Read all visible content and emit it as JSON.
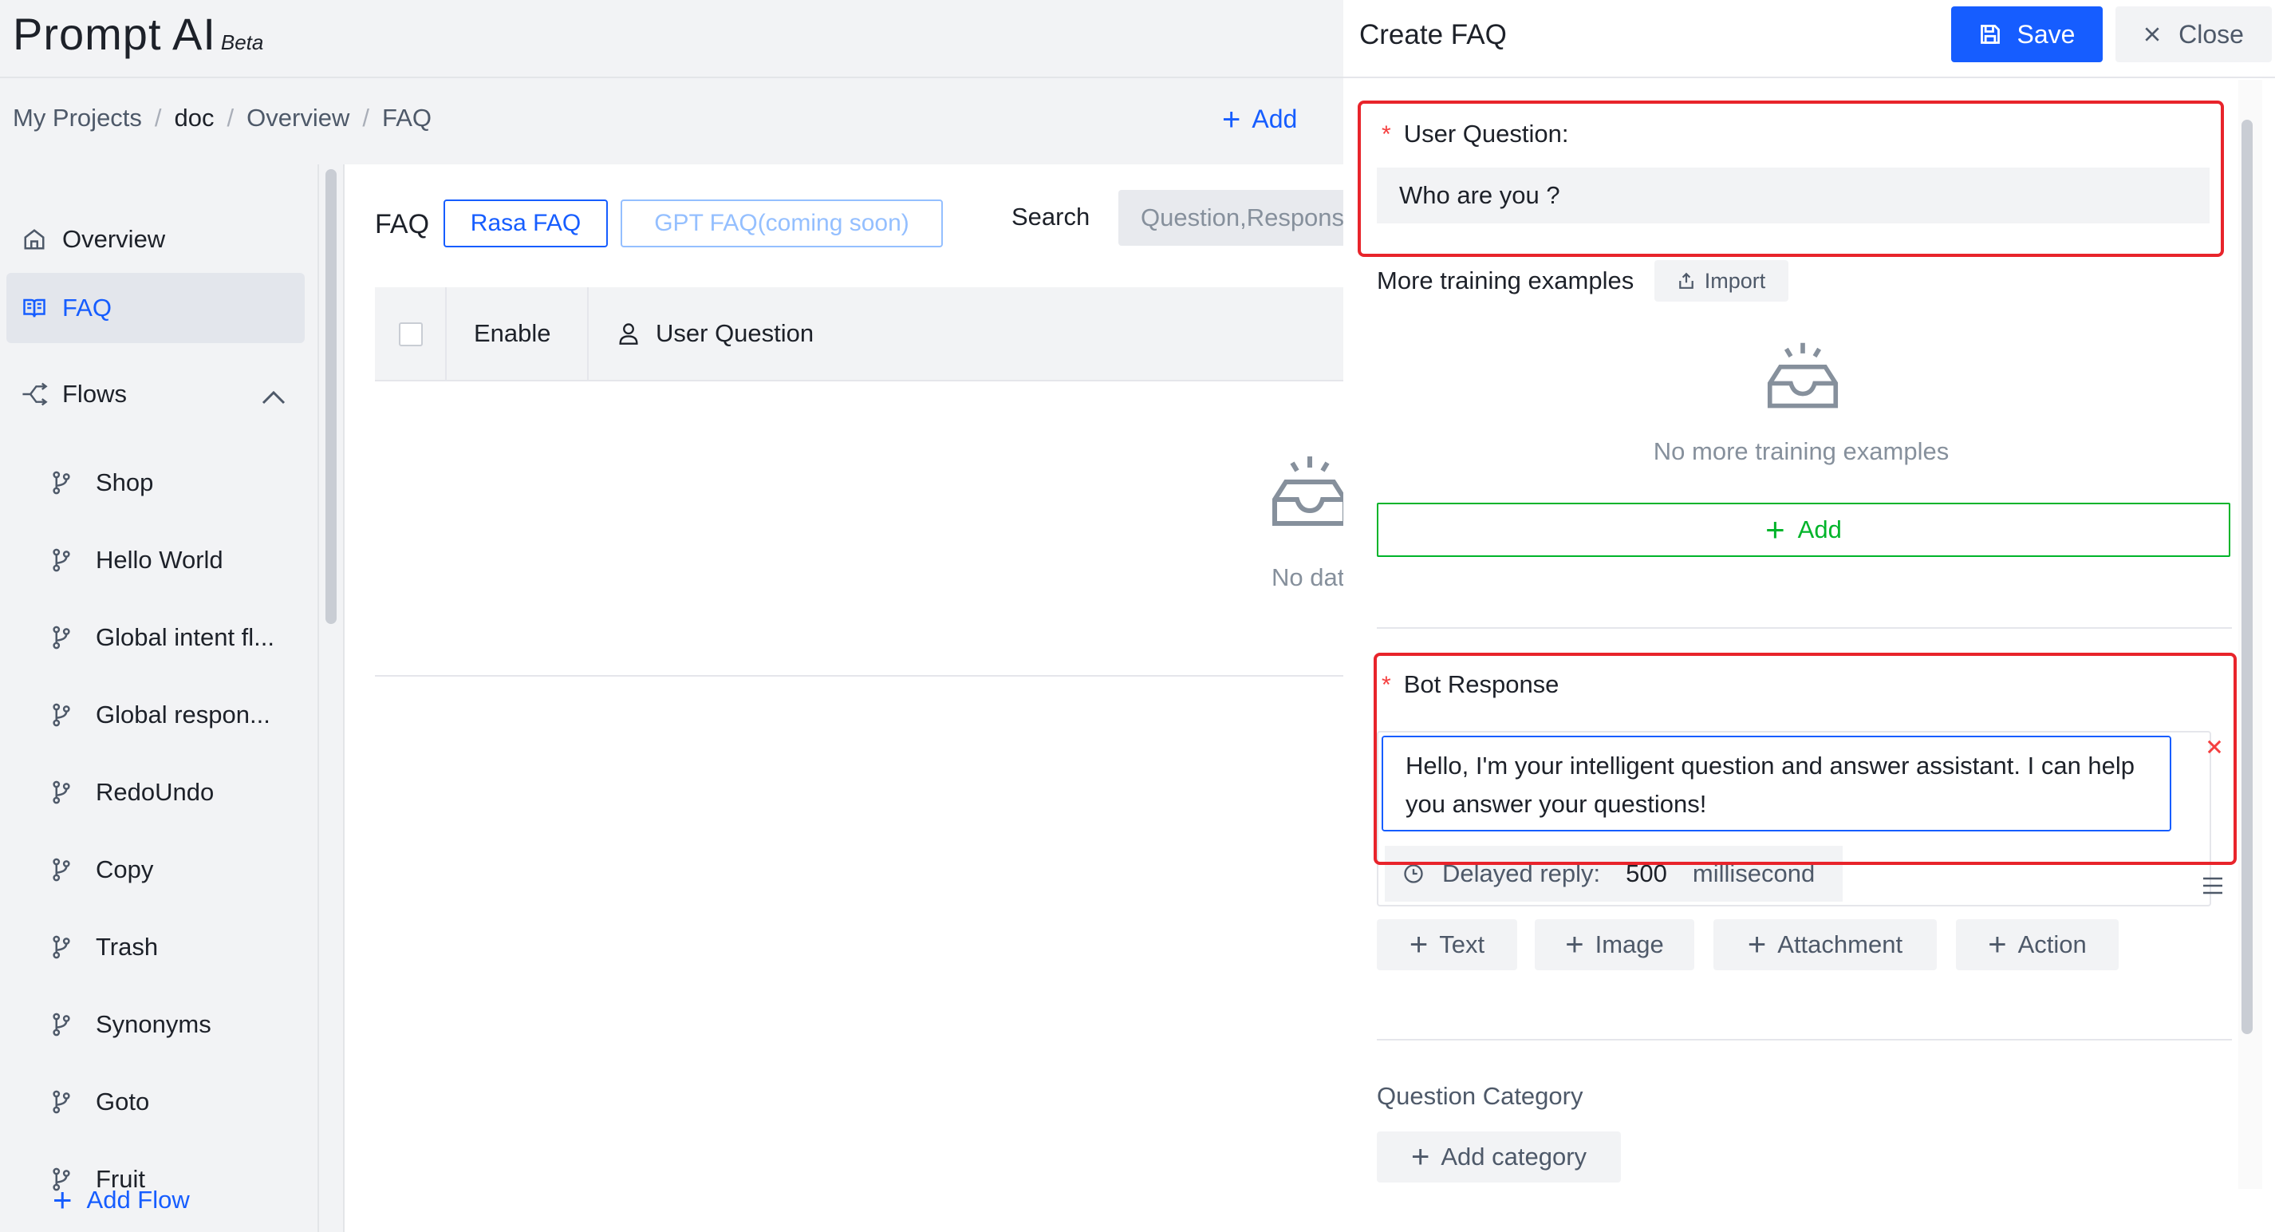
{
  "app": {
    "title": "Prompt AI",
    "badge": "Beta"
  },
  "breadcrumb": [
    "My Projects",
    "doc",
    "Overview",
    "FAQ"
  ],
  "header": {
    "add_label": "Add"
  },
  "sidebar": {
    "items": [
      {
        "label": "Overview",
        "icon": "home-icon"
      },
      {
        "label": "FAQ",
        "icon": "book-icon",
        "active": true
      },
      {
        "label": "Flows",
        "icon": "flow-icon"
      }
    ],
    "flows": [
      "Shop",
      "Hello World",
      "Global intent fl...",
      "Global respon...",
      "RedoUndo",
      "Copy",
      "Trash",
      "Synonyms",
      "Goto",
      "Fruit"
    ],
    "add_flow_label": "Add Flow"
  },
  "main": {
    "title": "FAQ",
    "tabs": [
      "Rasa FAQ",
      "GPT FAQ(coming soon)"
    ],
    "search_label": "Search",
    "search_placeholder": "Question,Respons",
    "table_headers": [
      "Enable",
      "User Question"
    ],
    "empty_text": "No dat"
  },
  "drawer": {
    "title": "Create FAQ",
    "save_label": "Save",
    "close_label": "Close",
    "user_question_label": "User Question:",
    "user_question_value": "Who are you ?",
    "more_examples_label": "More training examples",
    "import_label": "Import",
    "no_examples_text": "No more training examples",
    "add_label": "Add",
    "bot_response_label": "Bot Response",
    "bot_response_value": "Hello, I'm your intelligent question and answer assistant. I can help you answer your questions!",
    "delayed_reply_label": "Delayed reply:",
    "delayed_reply_value": "500",
    "delayed_reply_unit": "millisecond",
    "response_types": [
      "Text",
      "Image",
      "Attachment",
      "Action"
    ],
    "question_category_label": "Question Category",
    "add_category_label": "Add category"
  },
  "colors": {
    "primary": "#165dff",
    "success": "#00b42a",
    "danger": "#f53f3f",
    "highlight_box": "#e8242b"
  }
}
